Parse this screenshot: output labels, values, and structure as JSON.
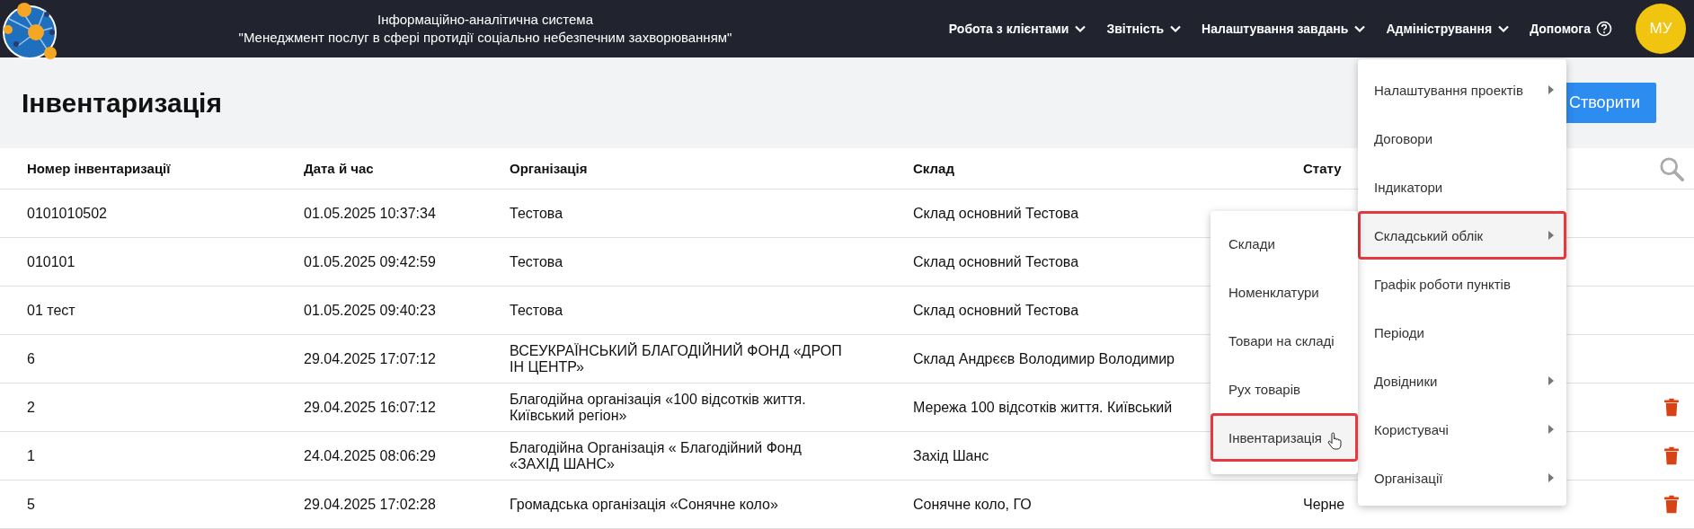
{
  "header": {
    "title_lines": [
      "Інформаційно-аналітична система",
      "\"Менеджмент послуг в сфері протидії соціально небезпечним захворюванням\""
    ],
    "nav": [
      {
        "kind": "dropdown",
        "label": "Робота з клієнтами"
      },
      {
        "kind": "dropdown",
        "label": "Звітність"
      },
      {
        "kind": "dropdown",
        "label": "Налаштування завдань"
      },
      {
        "kind": "dropdown",
        "label": "Адміністрування"
      },
      {
        "kind": "help",
        "label": "Допомога"
      }
    ],
    "avatar": "МУ"
  },
  "page": {
    "title": "Інвентаризація",
    "create_button": "Створити"
  },
  "table": {
    "columns": [
      "Номер інвентаризації",
      "Дата й час",
      "Організація",
      "Склад",
      "Стату"
    ],
    "rows": [
      {
        "number": "0101010502",
        "datetime": "01.05.2025 10:37:34",
        "organization": "Тестова",
        "warehouse": "Склад основний Тестова",
        "deletable": false
      },
      {
        "number": "010101",
        "datetime": "01.05.2025 09:42:59",
        "organization": "Тестова",
        "warehouse": "Склад основний Тестова",
        "deletable": false
      },
      {
        "number": "01 тест",
        "datetime": "01.05.2025 09:40:23",
        "organization": "Тестова",
        "warehouse": "Склад основний Тестова",
        "deletable": false
      },
      {
        "number": "6",
        "datetime": "29.04.2025 17:07:12",
        "organization": "ВСЕУКРАЇНСЬКИЙ БЛАГОДІЙНИЙ ФОНД «ДРОП ІН ЦЕНТР»",
        "warehouse": "Склад Андрєєв Володимир Володимир",
        "deletable": false
      },
      {
        "number": "2",
        "datetime": "29.04.2025 16:07:12",
        "organization": "Благодійна організація «100 відсотків життя. Київський регіон»",
        "warehouse": "Мережа 100 відсотків життя. Київський",
        "deletable": true
      },
      {
        "number": "1",
        "datetime": "24.04.2025 08:06:29",
        "organization": "Благодійна Організація « Благодійний Фонд «ЗАХІД ШАНС»",
        "warehouse": "Захід Шанс",
        "deletable": true
      },
      {
        "number": "5",
        "datetime": "29.04.2025 17:02:28",
        "organization": "Громадська організація «Сонячне коло»",
        "warehouse": "Сонячне коло, ГО",
        "status": "Черне",
        "deletable": true
      }
    ]
  },
  "menu": {
    "items": [
      {
        "label": "Налаштування проектів",
        "has_submenu": true,
        "selected": false
      },
      {
        "label": "Договори",
        "has_submenu": false,
        "selected": false
      },
      {
        "label": "Індикатори",
        "has_submenu": false,
        "selected": false
      },
      {
        "label": "Складський облік",
        "has_submenu": true,
        "selected": true
      },
      {
        "label": "Графік роботи пунктів",
        "has_submenu": false,
        "selected": false
      },
      {
        "label": "Періоди",
        "has_submenu": false,
        "selected": false
      },
      {
        "label": "Довідники",
        "has_submenu": true,
        "selected": false
      },
      {
        "label": "Користувачі",
        "has_submenu": true,
        "selected": false
      },
      {
        "label": "Організації",
        "has_submenu": true,
        "selected": false
      }
    ]
  },
  "submenu": {
    "items": [
      {
        "label": "Склади",
        "selected": false
      },
      {
        "label": "Номенклатури",
        "selected": false
      },
      {
        "label": "Товари на складі",
        "selected": false
      },
      {
        "label": "Рух товарів",
        "selected": false
      },
      {
        "label": "Інвентаризація",
        "selected": true
      }
    ]
  }
}
